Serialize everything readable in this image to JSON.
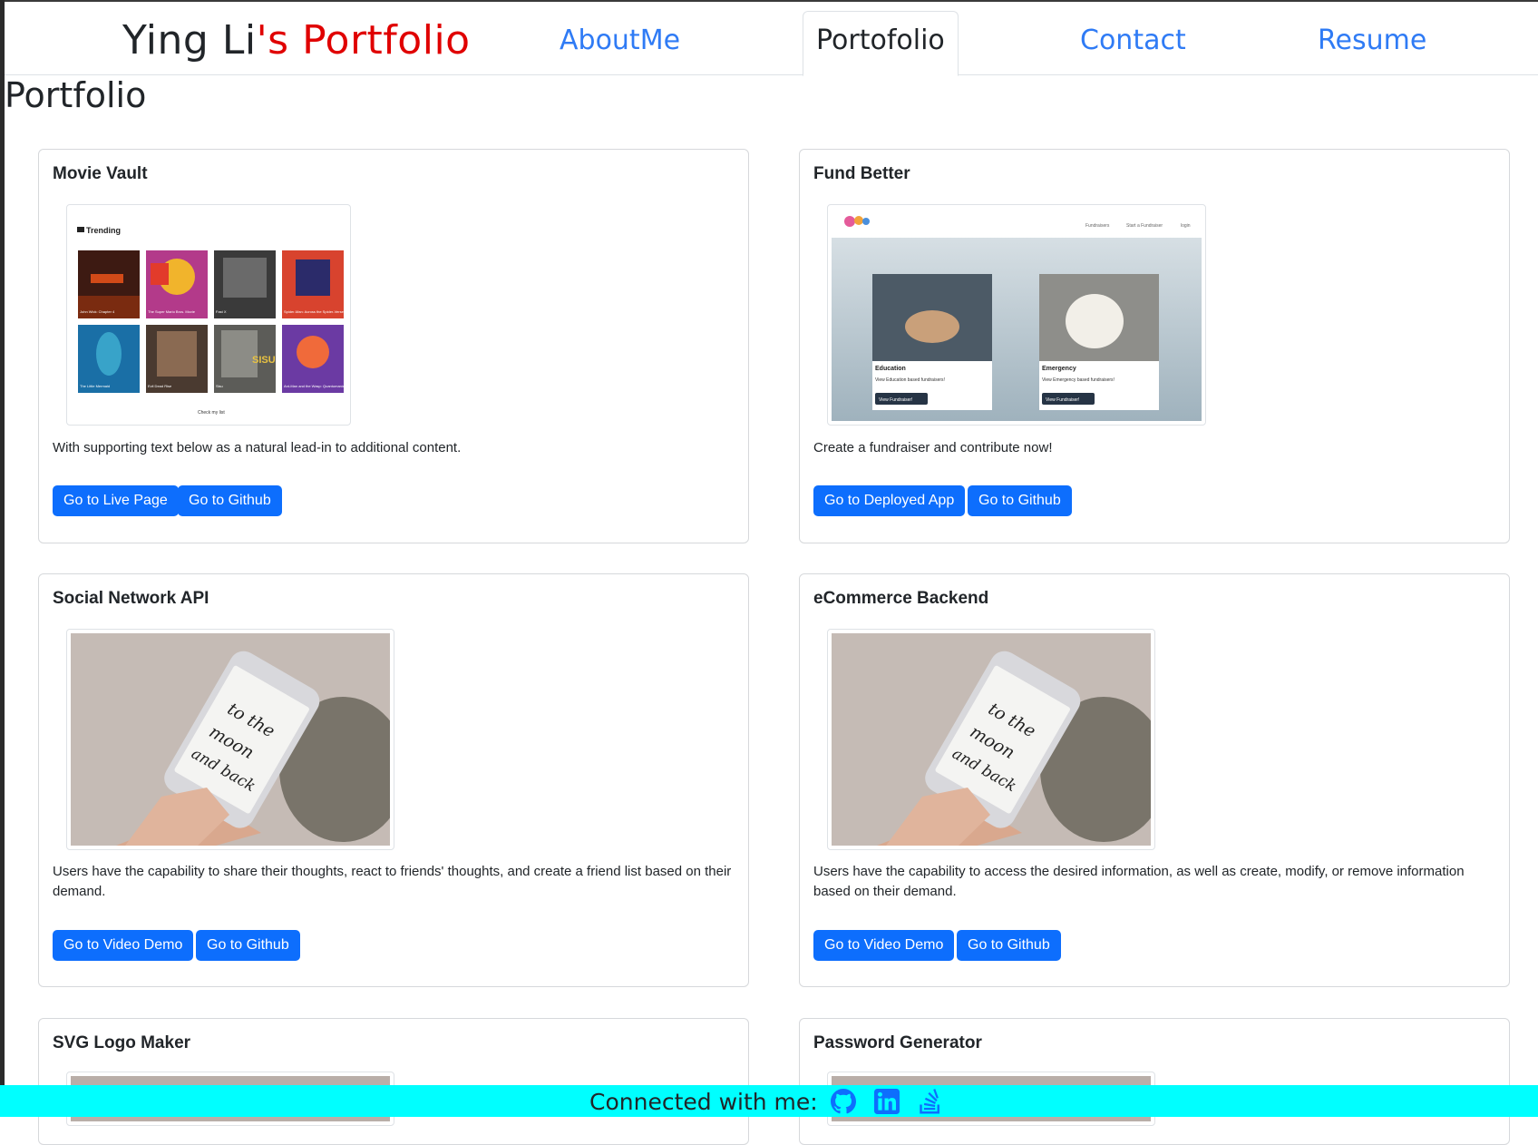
{
  "nav": {
    "brand_part1": "Ying Li",
    "brand_part2": "'s Portfolio",
    "links": [
      "AboutMe",
      "Portofolio",
      "Contact",
      "Resume"
    ],
    "active_link": "Portofolio"
  },
  "page": {
    "title": "Portfolio"
  },
  "projects": [
    {
      "title": "Movie Vault",
      "description": "With supporting text below as a natural lead-in to additional content.",
      "buttons": [
        "Go to Live Page",
        "Go to Github"
      ],
      "thumbnail": {
        "heading": "Trending",
        "posters": [
          "John Wick: Chapter 4",
          "The Super Mario Bros. Movie",
          "Fast X",
          "Spider-Man: Across the Spider-Verse",
          "The Little Mermaid",
          "Evil Dead Rise",
          "Sisu",
          "Ant-Man and the Wasp: Quantumania"
        ],
        "poster_word": "SISU",
        "footer_link": "Check my list"
      }
    },
    {
      "title": "Fund Better",
      "description": "Create a fundraiser and contribute now!",
      "buttons": [
        "Go to Deployed App",
        "Go to Github"
      ],
      "thumbnail": {
        "menu": [
          "Fundraisers",
          "Start a Fundraiser",
          "login"
        ],
        "cards": [
          {
            "title": "Education",
            "text": "View Education based fundraisers!",
            "button": "View Fundraiser!"
          },
          {
            "title": "Emergency",
            "text": "View Emergency based fundraisers!",
            "button": "View Fundraiser!"
          }
        ]
      }
    },
    {
      "title": "Social Network API",
      "description": "Users have the capability to share their thoughts, react to friends' thoughts, and create a friend list based on their demand.",
      "buttons": [
        "Go to Video Demo",
        "Go to Github"
      ],
      "thumbnail": {
        "handwriting": [
          "to the",
          "moon",
          "and back"
        ]
      }
    },
    {
      "title": "eCommerce Backend",
      "description": "Users have the capability to access the desired information, as well as create, modify, or remove information based on their demand.",
      "buttons": [
        "Go to Video Demo",
        "Go to Github"
      ],
      "thumbnail": {
        "handwriting": [
          "to the",
          "moon",
          "and back"
        ]
      }
    },
    {
      "title": "SVG Logo Maker"
    },
    {
      "title": "Password Generator"
    }
  ],
  "footer": {
    "text": "Connected with me:",
    "icons": [
      "github-icon",
      "linkedin-icon",
      "stackoverflow-icon"
    ]
  },
  "colors": {
    "brand_red": "#e00000",
    "link_blue": "#2f7bf5",
    "button_blue": "#0d6efd",
    "footer_cyan": "#00ffff"
  }
}
